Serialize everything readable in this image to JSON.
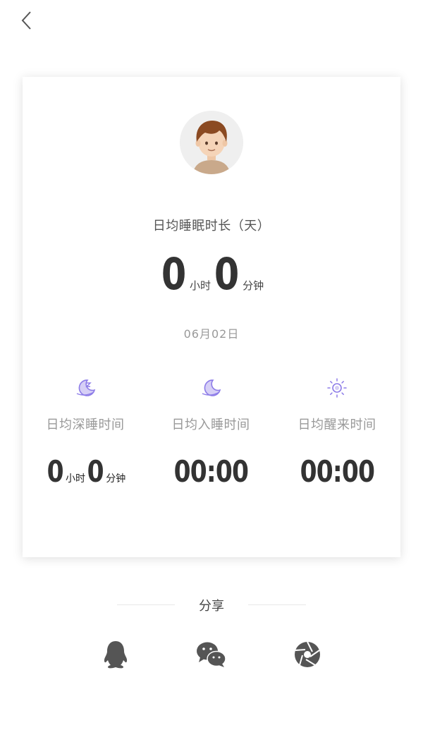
{
  "header": {
    "back_icon": "chevron-left-icon"
  },
  "card": {
    "avatar_icon": "boy-avatar-icon",
    "title": "日均睡眠时长（天）",
    "duration": {
      "hours": "0",
      "hours_unit": "小时",
      "minutes": "0",
      "minutes_unit": "分钟"
    },
    "date": "06月02日",
    "stats": [
      {
        "icon": "moon-zzz-icon",
        "label": "日均深睡时间",
        "hours": "0",
        "hours_unit": "小时",
        "minutes": "0",
        "minutes_unit": "分钟"
      },
      {
        "icon": "moon-icon",
        "label": "日均入睡时间",
        "value": "00:00"
      },
      {
        "icon": "sun-icon",
        "label": "日均醒来时间",
        "value": "00:00"
      }
    ]
  },
  "share": {
    "label": "分享",
    "targets": [
      {
        "icon": "qq-penguin-icon"
      },
      {
        "icon": "wechat-icon"
      },
      {
        "icon": "moments-aperture-icon"
      }
    ]
  },
  "colors": {
    "accent": "#8d7ce8",
    "text": "#333333",
    "muted": "#999999",
    "icon_gray": "#555555"
  }
}
